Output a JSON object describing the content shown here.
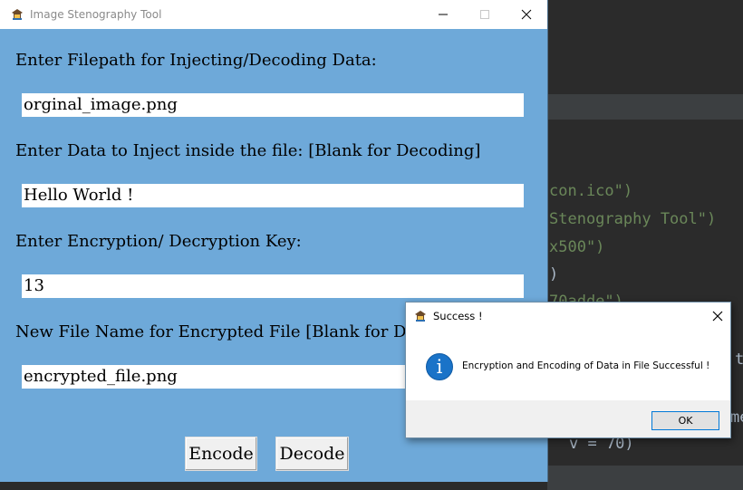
{
  "main_window": {
    "title": "Image Stenography Tool",
    "filepath_label": "Enter Filepath for Injecting/Decoding Data:",
    "filepath_value": "orginal_image.png",
    "data_label": "Enter Data to Inject inside the file: [Blank for Decoding]",
    "data_value": "Hello World !",
    "key_label": "Enter Encryption/ Decryption Key:",
    "key_value": "13",
    "newfile_label": "New File Name for Encrypted File [Blank for Decoding]",
    "newfile_value": "encrypted_file.png",
    "encode_label": "Encode",
    "decode_label": "Decode",
    "background_color": "#6ea9d9"
  },
  "dialog": {
    "title": "Success !",
    "message": "Encryption and Encoding of Data in File Successful !",
    "ok_label": "OK",
    "icon": "info-icon"
  },
  "background_code": {
    "line1": "con.ico\")",
    "line2": "Stenography Tool\")",
    "line3": "x500\")",
    "line4": ")",
    "line5": "70adde\")",
    "line6": "t",
    "line7": "me",
    "line8": "v = 70)"
  }
}
